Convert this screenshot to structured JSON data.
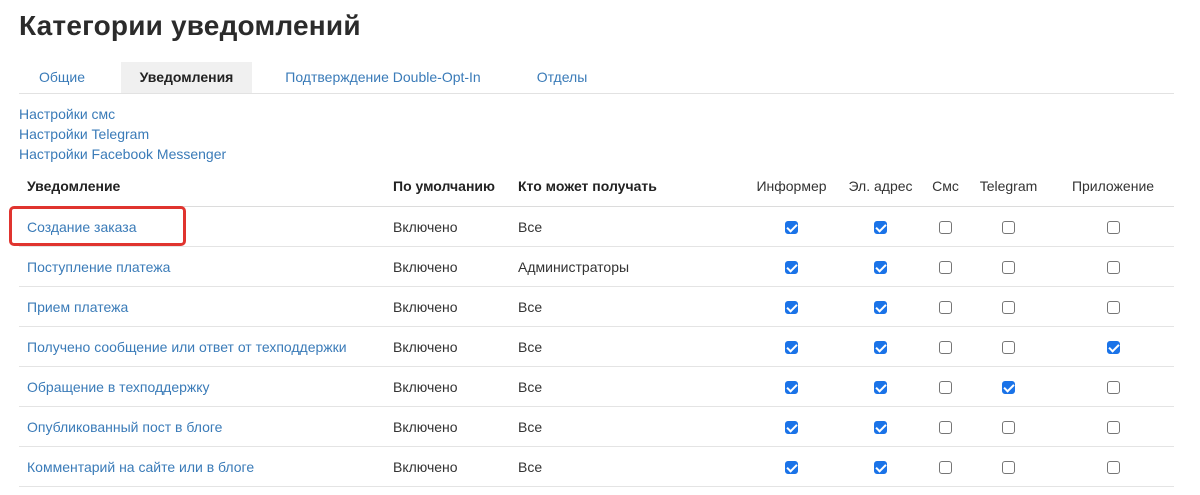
{
  "page_title": "Категории уведомлений",
  "tabs": [
    {
      "label": "Общие",
      "active": false
    },
    {
      "label": "Уведомления",
      "active": true
    },
    {
      "label": "Подтверждение Double-Opt-In",
      "active": false
    },
    {
      "label": "Отделы",
      "active": false
    }
  ],
  "settings_links": [
    "Настройки смс",
    "Настройки Telegram",
    "Настройки Facebook Messenger"
  ],
  "table": {
    "headers": [
      "Уведомление",
      "По умолчанию",
      "Кто может получать",
      "Информер",
      "Эл. адрес",
      "Смс",
      "Telegram",
      "Приложение"
    ],
    "rows": [
      {
        "name": "Создание заказа",
        "default": "Включено",
        "who": "Все",
        "checks": [
          true,
          true,
          false,
          false,
          false
        ],
        "highlighted": true
      },
      {
        "name": "Поступление платежа",
        "default": "Включено",
        "who": "Администраторы",
        "checks": [
          true,
          true,
          false,
          false,
          false
        ]
      },
      {
        "name": "Прием платежа",
        "default": "Включено",
        "who": "Все",
        "checks": [
          true,
          true,
          false,
          false,
          false
        ]
      },
      {
        "name": "Получено сообщение или ответ от техподдержки",
        "default": "Включено",
        "who": "Все",
        "checks": [
          true,
          true,
          false,
          false,
          true
        ]
      },
      {
        "name": "Обращение в техподдержку",
        "default": "Включено",
        "who": "Все",
        "checks": [
          true,
          true,
          false,
          true,
          false
        ]
      },
      {
        "name": "Опубликованный пост в блоге",
        "default": "Включено",
        "who": "Все",
        "checks": [
          true,
          true,
          false,
          false,
          false
        ]
      },
      {
        "name": "Комментарий на сайте или в блоге",
        "default": "Включено",
        "who": "Все",
        "checks": [
          true,
          true,
          false,
          false,
          false
        ]
      }
    ]
  },
  "colors": {
    "link": "#3a7bb8",
    "checkbox_checked": "#1a73e8",
    "highlight_box": "#e0342f"
  }
}
